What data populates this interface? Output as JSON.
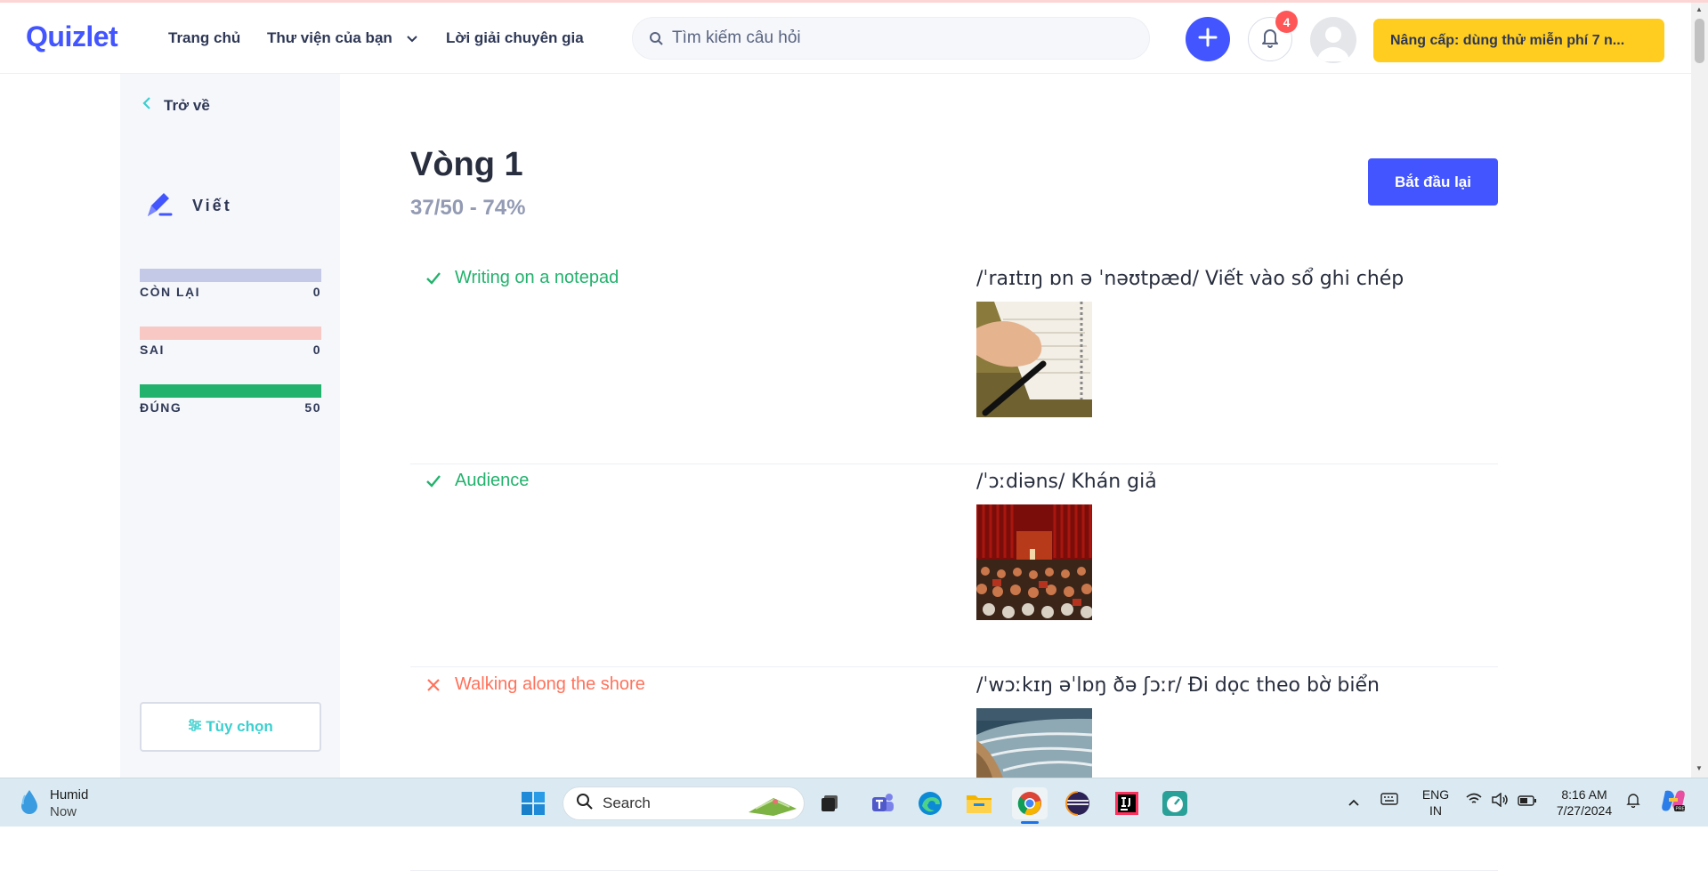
{
  "header": {
    "logo": "Quizlet",
    "nav": {
      "home": "Trang chủ",
      "library": "Thư viện của bạn",
      "expert": "Lời giải chuyên gia"
    },
    "search_placeholder": "Tìm kiếm câu hỏi",
    "notification_count": "4",
    "upgrade_label": "Nâng cấp: dùng thử miễn phí 7 n..."
  },
  "sidebar": {
    "back_label": "Trở về",
    "mode_label": "Viết",
    "progress": [
      {
        "label": "CÒN LẠI",
        "value": "0",
        "color": "#c5c9e8"
      },
      {
        "label": "SAI",
        "value": "0",
        "color": "#f8c8c4"
      },
      {
        "label": "ĐÚNG",
        "value": "50",
        "color": "#23b26d"
      }
    ],
    "options_label": "Tùy chọn"
  },
  "main": {
    "round_title": "Vòng 1",
    "round_score": "37/50 - 74%",
    "restart_label": "Bắt đầu lại",
    "results": [
      {
        "status": "correct",
        "term": "Writing on a notepad",
        "definition": "/ˈraɪtɪŋ ɒn ə ˈnəʊtpæd/ Viết vào sổ ghi chép",
        "image": "notepad-photo"
      },
      {
        "status": "correct",
        "term": "Audience",
        "definition": "/ˈɔːdiəns/ Khán giả",
        "image": "audience-photo"
      },
      {
        "status": "wrong",
        "term": "Walking along the shore",
        "definition": "/ˈwɔːkɪŋ əˈlɒŋ ðə ʃɔːr/ Đi dọc theo bờ biển",
        "image": "shore-photo"
      }
    ]
  },
  "taskbar": {
    "weather_title": "Humid",
    "weather_sub": "Now",
    "search_label": "Search",
    "lang_top": "ENG",
    "lang_bottom": "IN",
    "time": "8:16 AM",
    "date": "7/27/2024"
  },
  "colors": {
    "brand": "#4255ff",
    "correct": "#23b26d",
    "wrong": "#ff725b",
    "upgrade": "#ffcd1f"
  }
}
